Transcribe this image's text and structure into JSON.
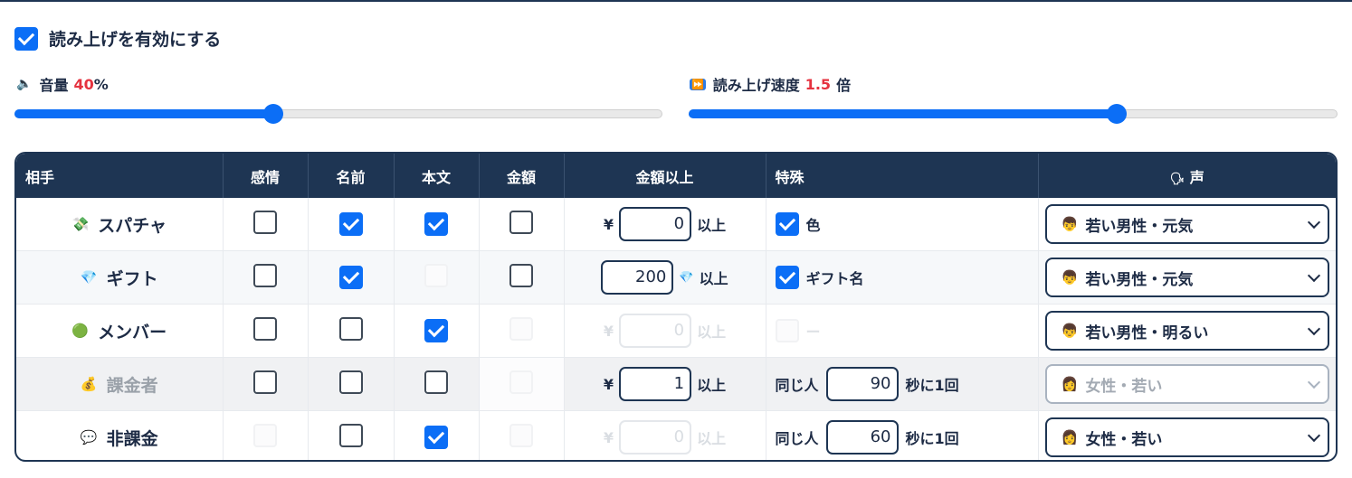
{
  "enable": {
    "label": "読み上げを有効にする",
    "checked": true
  },
  "volume": {
    "icon": "speaker-icon",
    "label": "音量",
    "value": "40",
    "unit": "%",
    "level": 0.4
  },
  "speed": {
    "icon": "fast-forward-icon",
    "label": "読み上げ速度",
    "value": "1.5",
    "unit": "倍",
    "level": 0.66
  },
  "table": {
    "headers": [
      "相手",
      "感情",
      "名前",
      "本文",
      "金額",
      "金額以上",
      "特殊",
      "声"
    ],
    "voice_header_icon": "speaking-head-icon",
    "rows": [
      {
        "name": "スパチャ",
        "icon": "money-wings-emoji",
        "emotion": "off",
        "nickname": "on",
        "body": "on",
        "amount": "off",
        "threshold": {
          "prefix": "¥",
          "value": "0",
          "suffix": "以上",
          "disabled": false
        },
        "special": {
          "type": "check",
          "checked": true,
          "label": "色"
        },
        "voice": {
          "label": "若い男性・元気",
          "disabled": false
        }
      },
      {
        "name": "ギフト",
        "icon": "gem-emoji",
        "emotion": "off",
        "nickname": "on",
        "body": "hidden",
        "amount": "off",
        "threshold": {
          "prefix": "",
          "value": "200",
          "suffix": "以上",
          "gem": true,
          "disabled": false
        },
        "special": {
          "type": "check",
          "checked": true,
          "label": "ギフト名"
        },
        "voice": {
          "label": "若い男性・元気",
          "disabled": false
        }
      },
      {
        "name": "メンバー",
        "icon": "green-circle-emoji",
        "emotion": "off",
        "nickname": "off",
        "body": "on",
        "amount": "hidden",
        "threshold": {
          "prefix": "¥",
          "value": "0",
          "suffix": "以上",
          "disabled": true
        },
        "special": {
          "type": "check-disabled",
          "label": "ー"
        },
        "voice": {
          "label": "若い男性・明るい",
          "disabled": false
        }
      },
      {
        "name": "課金者",
        "icon": "money-bag-emoji",
        "emotion": "off",
        "nickname": "off",
        "body": "off",
        "amount": "hidden",
        "threshold": {
          "prefix": "¥",
          "value": "1",
          "suffix": "以上",
          "disabled": false
        },
        "special": {
          "type": "interval",
          "before": "同じ人",
          "value": "90",
          "after": "秒に1回"
        },
        "voice": {
          "label": "女性・若い",
          "disabled": true
        }
      },
      {
        "name": "非課金",
        "icon": "speech-balloon-emoji",
        "emotion": "hidden",
        "nickname": "off",
        "body": "on",
        "amount": "hidden",
        "threshold": {
          "prefix": "¥",
          "value": "0",
          "suffix": "以上",
          "disabled": true
        },
        "special": {
          "type": "interval",
          "before": "同じ人",
          "value": "60",
          "after": "秒に1回"
        },
        "voice": {
          "label": "女性・若い",
          "disabled": false
        }
      }
    ]
  }
}
